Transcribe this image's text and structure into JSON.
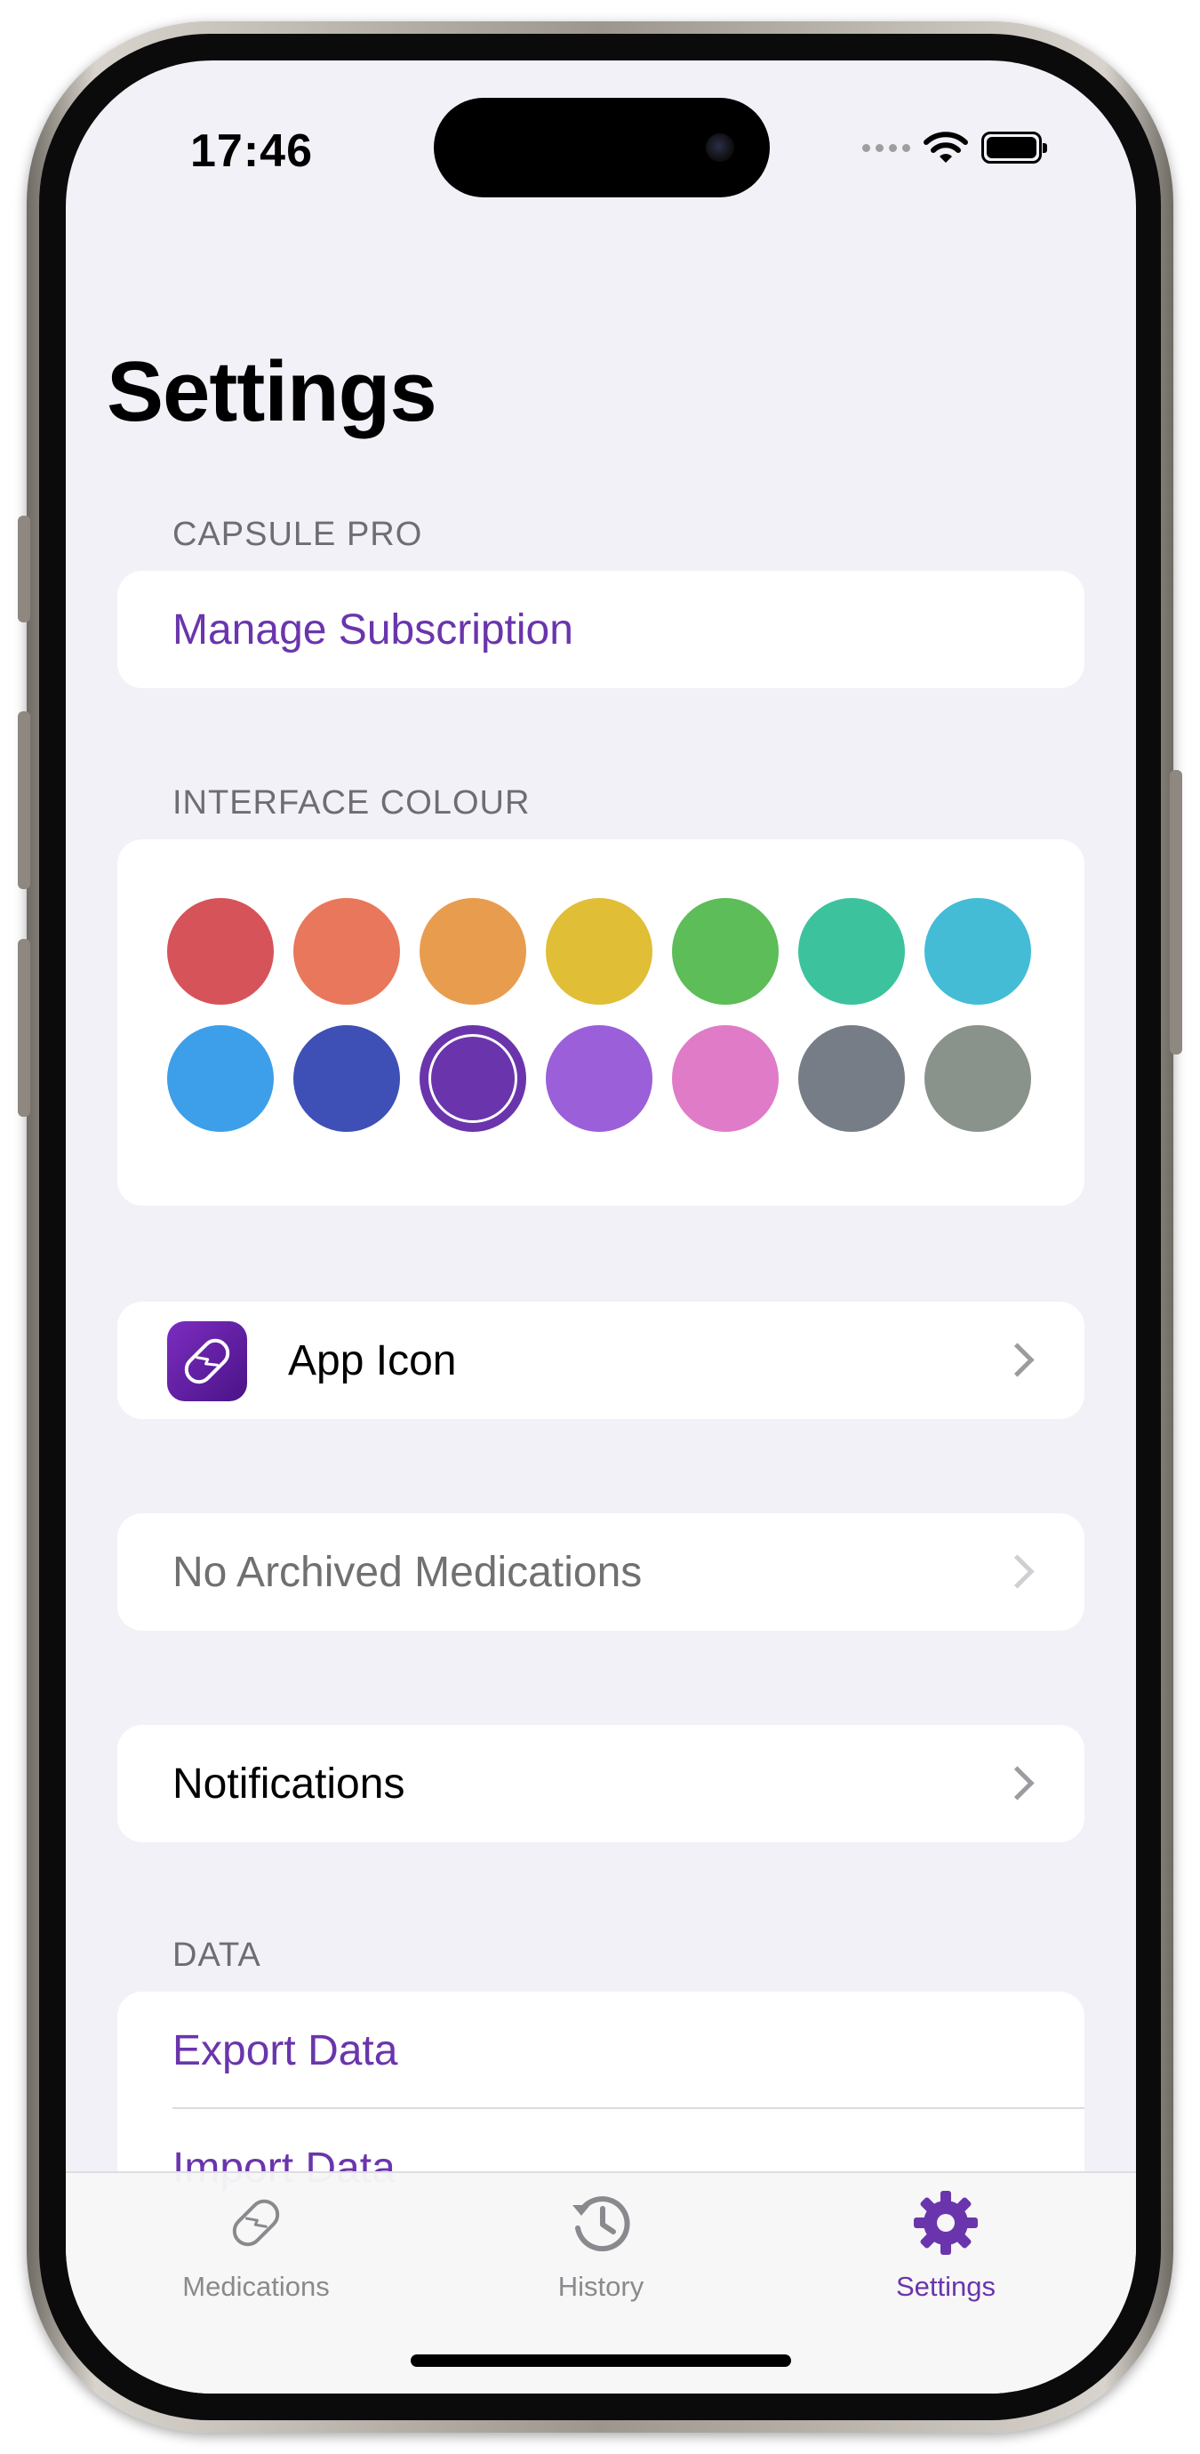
{
  "status_bar": {
    "time": "17:46"
  },
  "page": {
    "title": "Settings"
  },
  "sections": {
    "capsule_pro": {
      "label": "CAPSULE PRO",
      "manage_subscription": "Manage Subscription"
    },
    "interface_colour": {
      "label": "INTERFACE COLOUR",
      "colors": [
        "#d6535a",
        "#e9775c",
        "#e89c4e",
        "#e0be36",
        "#5cbd59",
        "#3cc39e",
        "#44bcd5",
        "#3d9fe9",
        "#3e4fb5",
        "#6a35ac",
        "#9b5fd9",
        "#e07bc8",
        "#777d87",
        "#8a938b"
      ],
      "selected_color": "#6a35ac"
    },
    "app_icon": {
      "label": "App Icon"
    },
    "archived": {
      "label": "No Archived Medications"
    },
    "notifications": {
      "label": "Notifications"
    },
    "data": {
      "label": "DATA",
      "export": "Export Data",
      "import": "Import Data"
    }
  },
  "tabbar": {
    "tabs": [
      {
        "label": "Medications",
        "icon": "pill-icon",
        "active": false
      },
      {
        "label": "History",
        "icon": "history-icon",
        "active": false
      },
      {
        "label": "Settings",
        "icon": "gear-icon",
        "active": true
      }
    ]
  },
  "colors": {
    "accent": "#6a35ac",
    "background": "#f2f1f7",
    "muted_text": "#707070"
  }
}
